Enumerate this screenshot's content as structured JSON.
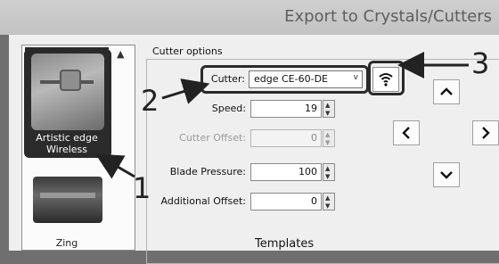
{
  "window": {
    "title": "Export to Crystals/Cutters"
  },
  "devices": [
    {
      "label": "Artistic edge\nWireless",
      "selected": true,
      "icon": "cutter-machine-icon"
    },
    {
      "label": "Zing",
      "selected": false,
      "icon": "cutter-machine-icon"
    }
  ],
  "cutter_options": {
    "title": "Cutter options",
    "cutter_label": "Cutter:",
    "cutter_value": "edge CE-60-DE",
    "speed_label": "Speed:",
    "speed_value": "19",
    "offset_label": "Cutter Offset:",
    "offset_value": "0",
    "pressure_label": "Blade Pressure:",
    "pressure_value": "100",
    "additional_label": "Additional Offset:",
    "additional_value": "0"
  },
  "templates": {
    "title": "Templates"
  },
  "icons": {
    "wifi": "wifi-icon",
    "up": "chevron-up-icon",
    "left": "chevron-left-icon",
    "right": "chevron-right-icon",
    "down": "chevron-down-icon"
  },
  "annotations": [
    "1",
    "2",
    "3"
  ]
}
